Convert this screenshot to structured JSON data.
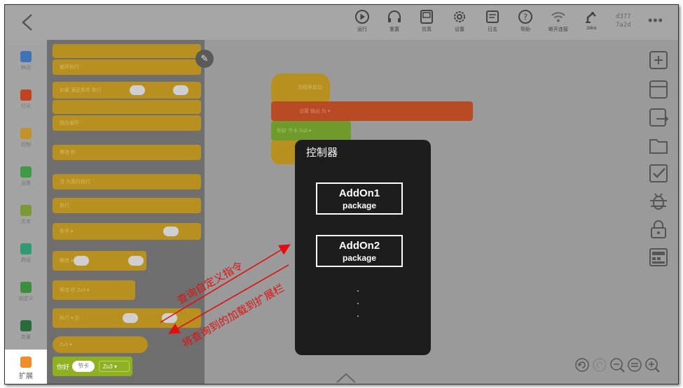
{
  "topbar": {
    "back_icon": "chevron-left-icon",
    "tools": [
      {
        "icon": "play-icon",
        "label": "运行"
      },
      {
        "icon": "headphone-icon",
        "label": "重置"
      },
      {
        "icon": "simulator-icon",
        "label": "仿真"
      },
      {
        "icon": "settings-icon",
        "label": "设置"
      },
      {
        "icon": "log-icon",
        "label": "日志"
      },
      {
        "icon": "help-icon",
        "label": "帮助"
      },
      {
        "icon": "wifi-icon",
        "label": "断开连接"
      },
      {
        "icon": "robot-icon",
        "label": "Jaka"
      }
    ],
    "device_id_line1": "d377",
    "device_id_line2": "7a2d",
    "more_label": "•••"
  },
  "categories": [
    {
      "label": "移动",
      "color": "#3f73b8"
    },
    {
      "label": "灯光",
      "color": "#c0431f"
    },
    {
      "label": "控制",
      "color": "#c3922a"
    },
    {
      "label": "运算",
      "color": "#3f9a45"
    },
    {
      "label": "文本",
      "color": "#7a9a36"
    },
    {
      "label": "数组",
      "color": "#2f9a73"
    },
    {
      "label": "自定义",
      "color": "#3b8f3b"
    },
    {
      "label": "变量",
      "color": "#276c3a"
    },
    {
      "label": "扩展",
      "color": "#f08c2a"
    }
  ],
  "palette": {
    "blocks": [
      "循环执行",
      "如果 满足条件 执行",
      "跳出循环",
      "等待 秒",
      "当 为真时执行",
      "执行",
      "条件 ▾",
      "等待 ▾",
      "等待 秒 Zu3 ▾",
      "执行 ▾ 至",
      "Zu3 ▾"
    ]
  },
  "workspace": {
    "blocks": [
      "当程序启动",
      "设置 输出 为 ▾",
      "你好 节卡 Zu3 ▾"
    ]
  },
  "extension_block": {
    "hello": "你好",
    "pill": "节卡",
    "dropdown": "Zu3"
  },
  "right_tools": [
    "add-icon",
    "save-icon",
    "export-icon",
    "folder-icon",
    "check-icon",
    "debug-icon",
    "lock-icon",
    "keyboard-icon"
  ],
  "zoom_tools": [
    "undo-icon",
    "redo-icon",
    "zoom-out-icon",
    "zoom-reset-icon",
    "zoom-in-icon"
  ],
  "overlay": {
    "title": "控制器",
    "packages": [
      {
        "name": "AddOn1",
        "type": "package"
      },
      {
        "name": "AddOn2",
        "type": "package"
      }
    ],
    "ellipsis": [
      ".",
      ".",
      "."
    ]
  },
  "annotations": {
    "query": "查询自定义指令",
    "load": "将查询到的加载到扩展栏"
  },
  "colors": {
    "annotation": "#e01010",
    "overlay_bg": "#1d1d1d",
    "extension_green": "#8fb021"
  }
}
